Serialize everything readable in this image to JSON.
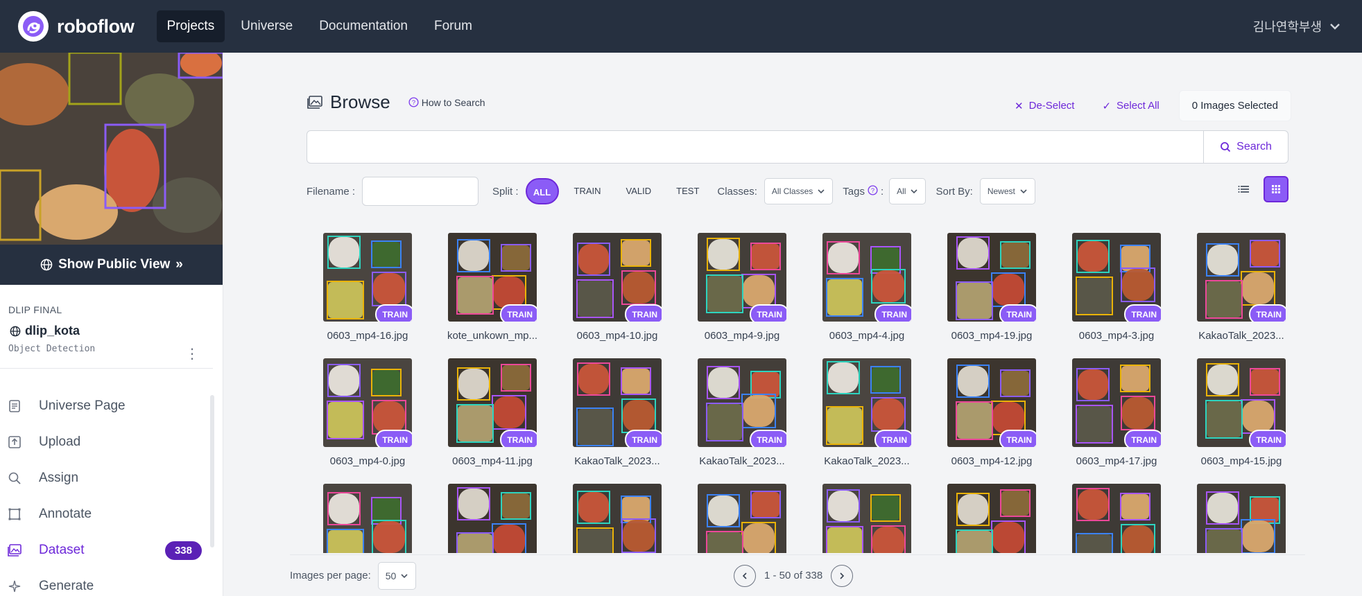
{
  "nav": {
    "brand": "roboflow",
    "links": [
      "Projects",
      "Universe",
      "Documentation",
      "Forum"
    ],
    "user": "김나연학부생"
  },
  "sidebar": {
    "public_view": "Show Public View",
    "workspace": "DLIP FINAL",
    "project_name": "dlip_kota",
    "project_type": "Object Detection",
    "items": [
      {
        "label": "Universe Page",
        "icon": "universe-page-icon"
      },
      {
        "label": "Upload",
        "icon": "upload-icon"
      },
      {
        "label": "Assign",
        "icon": "assign-search-icon"
      },
      {
        "label": "Annotate",
        "icon": "annotate-icon"
      },
      {
        "label": "Dataset",
        "icon": "dataset-icon",
        "badge": "338"
      },
      {
        "label": "Generate",
        "icon": "generate-icon"
      }
    ]
  },
  "browse": {
    "title": "Browse",
    "how_to_search": "How to Search",
    "deselect": "De-Select",
    "select_all": "Select All",
    "selected_count": "0 Images Selected",
    "search_button": "Search",
    "search_value": ""
  },
  "filters": {
    "filename_label": "Filename :",
    "filename_value": "",
    "split_label": "Split :",
    "split_options": [
      "ALL",
      "TRAIN",
      "VALID",
      "TEST"
    ],
    "classes_label": "Classes:",
    "classes_value": "All Classes",
    "tags_label": "Tags",
    "tags_value": "All",
    "sort_label": "Sort By:",
    "sort_value": "Newest"
  },
  "images": [
    {
      "name": "0603_mp4-16.jpg",
      "split": "TRAIN"
    },
    {
      "name": "kote_unkown_mp...",
      "split": "TRAIN"
    },
    {
      "name": "0603_mp4-10.jpg",
      "split": "TRAIN"
    },
    {
      "name": "0603_mp4-9.jpg",
      "split": "TRAIN"
    },
    {
      "name": "0603_mp4-4.jpg",
      "split": "TRAIN"
    },
    {
      "name": "0603_mp4-19.jpg",
      "split": "TRAIN"
    },
    {
      "name": "0603_mp4-3.jpg",
      "split": "TRAIN"
    },
    {
      "name": "KakaoTalk_2023...",
      "split": "TRAIN"
    },
    {
      "name": "0603_mp4-0.jpg",
      "split": "TRAIN"
    },
    {
      "name": "0603_mp4-11.jpg",
      "split": "TRAIN"
    },
    {
      "name": "KakaoTalk_2023...",
      "split": "TRAIN"
    },
    {
      "name": "KakaoTalk_2023...",
      "split": "TRAIN"
    },
    {
      "name": "KakaoTalk_2023...",
      "split": "TRAIN"
    },
    {
      "name": "0603_mp4-12.jpg",
      "split": "TRAIN"
    },
    {
      "name": "0603_mp4-17.jpg",
      "split": "TRAIN"
    },
    {
      "name": "0603_mp4-15.jpg",
      "split": "TRAIN"
    },
    {
      "name": "",
      "split": ""
    },
    {
      "name": "",
      "split": ""
    },
    {
      "name": "",
      "split": ""
    },
    {
      "name": "",
      "split": ""
    },
    {
      "name": "",
      "split": ""
    },
    {
      "name": "",
      "split": ""
    },
    {
      "name": "",
      "split": ""
    },
    {
      "name": "",
      "split": ""
    }
  ],
  "pager": {
    "per_page_label": "Images per page:",
    "per_page_value": "50",
    "range": "1 - 50 of 338"
  },
  "colors": {
    "accent": "#8b5cf6",
    "accent_dark": "#6d28d9",
    "nav_bg": "#263040"
  }
}
